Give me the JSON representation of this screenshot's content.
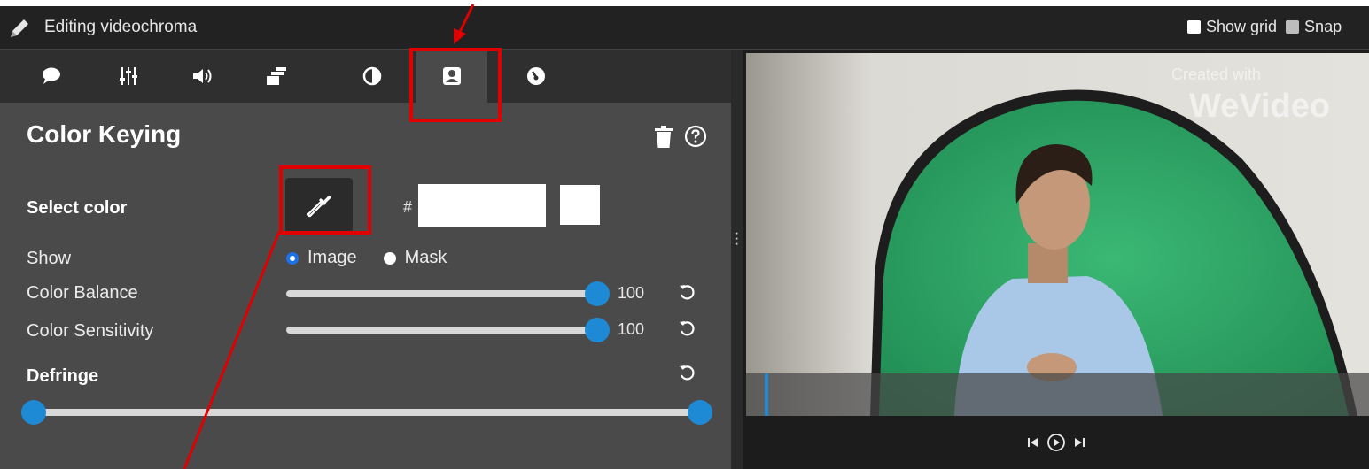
{
  "header": {
    "title": "Editing videochroma",
    "show_grid_label": "Show grid",
    "snap_label": "Snap"
  },
  "tabs": [
    {
      "icon": "speech-bubble-icon"
    },
    {
      "icon": "sliders-icon"
    },
    {
      "icon": "speaker-icon"
    },
    {
      "icon": "layers-icon"
    },
    {
      "icon": "contrast-icon"
    },
    {
      "icon": "person-badge-icon",
      "active": true
    },
    {
      "icon": "speedometer-icon"
    }
  ],
  "panel": {
    "title": "Color Keying",
    "select_color_label": "Select color",
    "hash_symbol": "#",
    "hex_value": "",
    "swatch_color": "#ffffff",
    "show_label": "Show",
    "show_options": {
      "image": "Image",
      "mask": "Mask",
      "selected": "Image"
    },
    "color_balance_label": "Color Balance",
    "color_balance_value": "100",
    "color_sensitivity_label": "Color Sensitivity",
    "color_sensitivity_value": "100",
    "defringe_label": "Defringe",
    "defringe_range": {
      "low": 0,
      "high": 1
    }
  },
  "preview": {
    "watermark_top": "Created with",
    "watermark_brand": "WeVideo",
    "playhead_fraction": 0.03
  },
  "colors": {
    "accent": "#1e8ad6",
    "annotation_red": "#e00000",
    "greenscreen": "#2fa868",
    "panel_bg": "#4a4a4a"
  }
}
